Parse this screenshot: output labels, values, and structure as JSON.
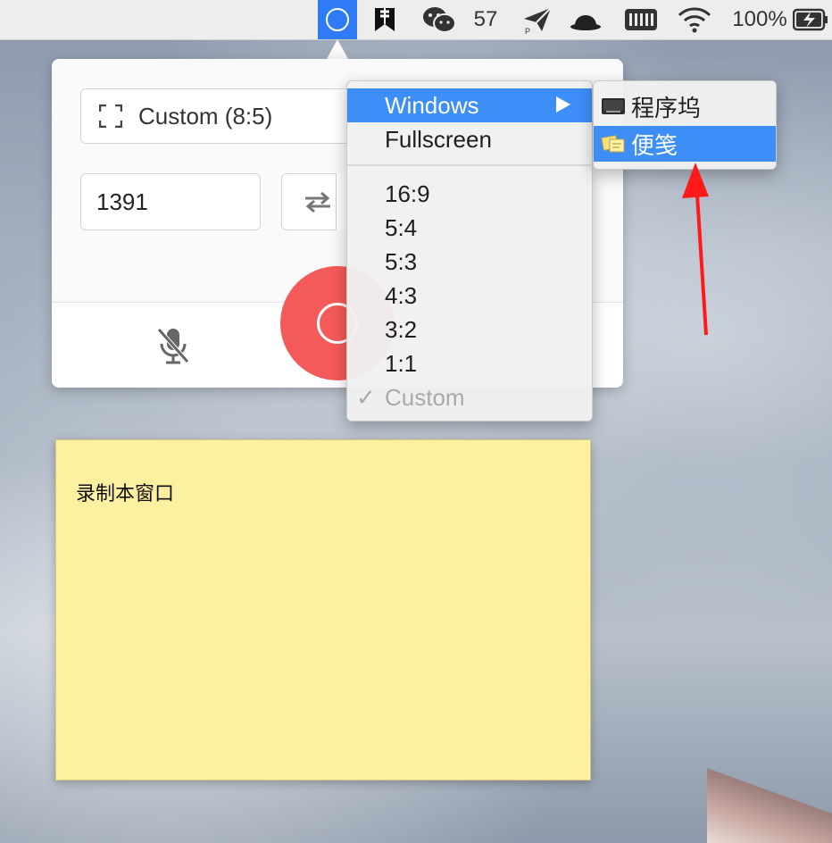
{
  "menubar": {
    "wechat_count": "57",
    "battery_percent": "100%",
    "icons": [
      "screen-recorder-icon",
      "bookmark-app-icon",
      "wechat-icon",
      "paper-plane-icon",
      "bowler-hat-icon",
      "memory-icon",
      "wifi-icon",
      "battery-charging-icon"
    ]
  },
  "recorder": {
    "ratio_label": "Custom (8:5)",
    "width_value": "1391"
  },
  "menu": {
    "items": [
      {
        "label": "Windows"
      },
      {
        "label": "Fullscreen"
      },
      {
        "label": "16:9"
      },
      {
        "label": "5:4"
      },
      {
        "label": "5:3"
      },
      {
        "label": "4:3"
      },
      {
        "label": "3:2"
      },
      {
        "label": "1:1"
      },
      {
        "label": "Custom"
      }
    ],
    "check_mark": "✓"
  },
  "submenu": {
    "items": [
      {
        "label": "程序坞"
      },
      {
        "label": "便笺"
      }
    ]
  },
  "sticky_note": {
    "text": "录制本窗口"
  },
  "colors": {
    "accent": "#3d8ef7",
    "record": "#f55a5a",
    "sticky": "#fdf0a1",
    "annotation_arrow": "#ff1a1a"
  }
}
